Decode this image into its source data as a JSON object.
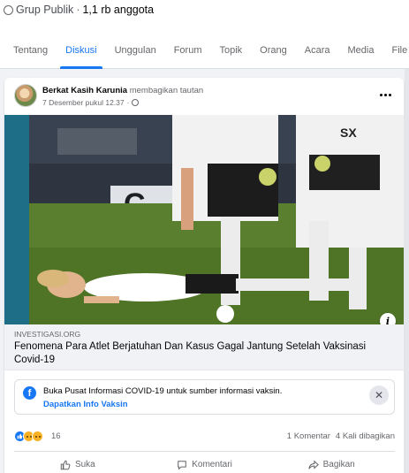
{
  "group": {
    "privacy": "Grup Publik",
    "separator": "·",
    "members": "1,1 rb anggota"
  },
  "tabs": [
    "Tentang",
    "Diskusi",
    "Unggulan",
    "Forum",
    "Topik",
    "Orang",
    "Acara",
    "Media",
    "File"
  ],
  "active_tab": "Diskusi",
  "post": {
    "author": "Berkat Kasih Karunia",
    "action": "membagikan tautan",
    "timestamp": "7 Desember pukul 12.37",
    "separator": "·",
    "link": {
      "domain": "INVESTIGASI.ORG",
      "title": "Fenomena Para Atlet Berjatuhan Dan Kasus Gagal Jantung Setelah Vaksinasi Covid-19"
    },
    "info_icon": "i",
    "covid_notice": {
      "text": "Buka Pusat Informasi COVID-19 untuk sumber informasi vaksin.",
      "link": "Dapatkan Info Vaksin",
      "close": "✕"
    },
    "reactions": {
      "icons": [
        "like-icon",
        "sad-icon",
        "wow-icon"
      ],
      "count": "16",
      "comments": "1 Komentar",
      "shares": "4 Kali dibagikan"
    },
    "actions": {
      "like": "Suka",
      "comment": "Komentari",
      "share": "Bagikan"
    }
  },
  "colors": {
    "accent": "#1877f2",
    "background": "#f0f2f5",
    "text_secondary": "#65676b"
  }
}
